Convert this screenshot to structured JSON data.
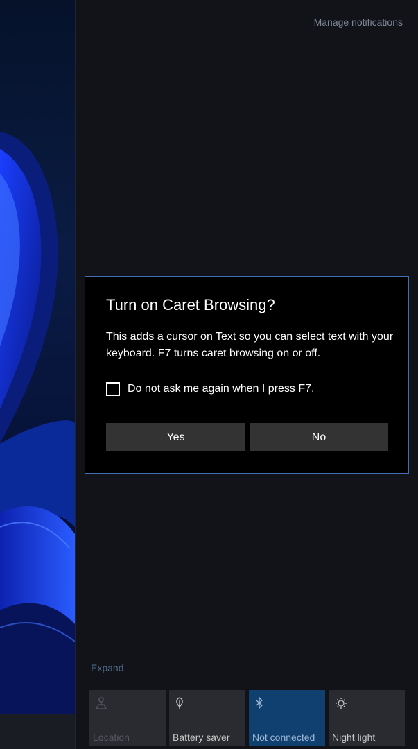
{
  "action_center": {
    "manage_notifications": "Manage notifications",
    "expand": "Expand"
  },
  "dialog": {
    "title": "Turn on Caret Browsing?",
    "body": "This adds a cursor on Text so you can select text with your keyboard. F7 turns caret browsing on or off.",
    "checkbox_label": "Do not ask me again when I press F7.",
    "checkbox_checked": false,
    "yes_label": "Yes",
    "no_label": "No"
  },
  "quick_actions": [
    {
      "label": "Location",
      "icon": "location-icon",
      "state": "disabled"
    },
    {
      "label": "Battery saver",
      "icon": "battery-saver-icon",
      "state": "off"
    },
    {
      "label": "Not connected",
      "icon": "bluetooth-icon",
      "state": "on"
    },
    {
      "label": "Night light",
      "icon": "night-light-icon",
      "state": "off"
    }
  ],
  "colors": {
    "accent": "#0f4070",
    "dialog_border": "#3f6fb2",
    "button": "#333333",
    "tile": "#2a2b30"
  }
}
